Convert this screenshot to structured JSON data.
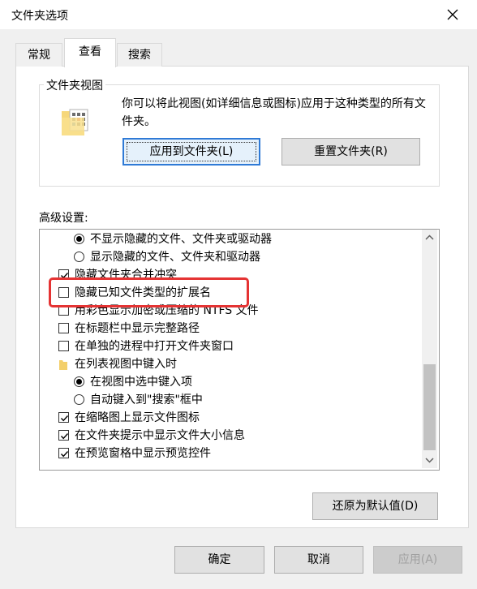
{
  "window": {
    "title": "文件夹选项"
  },
  "tabs": [
    {
      "label": "常规"
    },
    {
      "label": "查看"
    },
    {
      "label": "搜索"
    }
  ],
  "folder_views": {
    "legend": "文件夹视图",
    "description": "你可以将此视图(如详细信息或图标)应用于这种类型的所有文件夹。",
    "apply_button": "应用到文件夹(L)",
    "reset_button": "重置文件夹(R)"
  },
  "advanced": {
    "label": "高级设置:",
    "items": [
      {
        "type": "radio",
        "checked": true,
        "label": "不显示隐藏的文件、文件夹或驱动器"
      },
      {
        "type": "radio",
        "checked": false,
        "label": "显示隐藏的文件、文件夹和驱动器"
      },
      {
        "type": "checkbox",
        "checked": true,
        "label": "隐藏文件夹合并冲突"
      },
      {
        "type": "checkbox",
        "checked": false,
        "label": "隐藏已知文件类型的扩展名"
      },
      {
        "type": "checkbox",
        "checked": false,
        "label": "用彩色显示加密或压缩的 NTFS 文件"
      },
      {
        "type": "checkbox",
        "checked": false,
        "label": "在标题栏中显示完整路径"
      },
      {
        "type": "checkbox",
        "checked": false,
        "label": "在单独的进程中打开文件夹窗口"
      },
      {
        "type": "folder",
        "label": "在列表视图中键入时"
      },
      {
        "type": "radio",
        "checked": true,
        "label": "在视图中选中键入项"
      },
      {
        "type": "radio",
        "checked": false,
        "label": "自动键入到\"搜索\"框中"
      },
      {
        "type": "checkbox",
        "checked": true,
        "label": "在缩略图上显示文件图标"
      },
      {
        "type": "checkbox",
        "checked": true,
        "label": "在文件夹提示中显示文件大小信息"
      },
      {
        "type": "checkbox",
        "checked": true,
        "label": "在预览窗格中显示预览控件"
      }
    ]
  },
  "buttons": {
    "restore_defaults": "还原为默认值(D)",
    "ok": "确定",
    "cancel": "取消",
    "apply": "应用(A)"
  },
  "colors": {
    "accent": "#2f7ad6",
    "highlight": "#e53333"
  }
}
